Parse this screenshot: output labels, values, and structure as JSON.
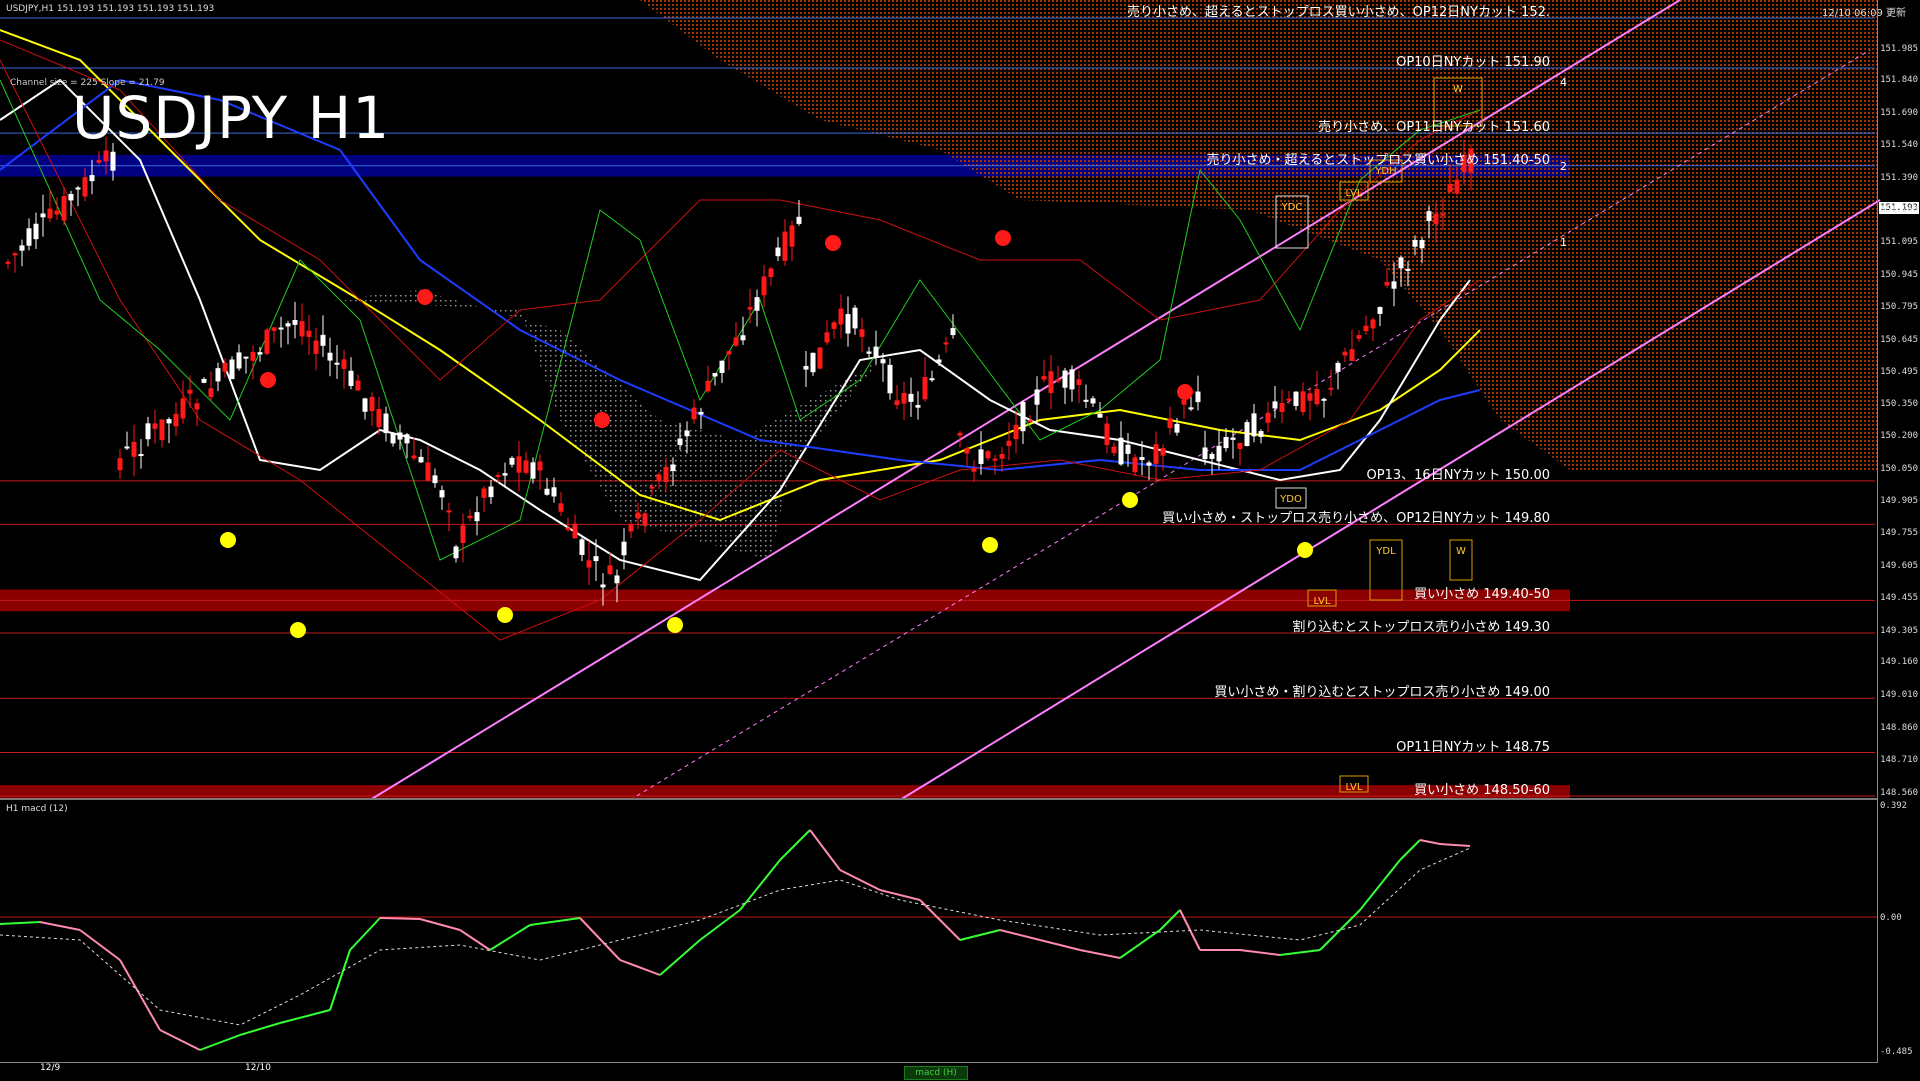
{
  "header": {
    "symbol_info": "USDJPY,H1  151.193 151.193 151.193 151.193",
    "timestamp": "12/10 06:09 更新",
    "title": "USDJPY H1",
    "channel_info": "Channel size = 225 Slope = 21.79"
  },
  "macd_panel": {
    "label": "H1  macd (12)",
    "tab_label": "macd (H)",
    "axis": [
      "0.392",
      "0.00",
      "-0.485"
    ]
  },
  "price_axis": [
    "151.985",
    "151.840",
    "151.690",
    "151.540",
    "151.390",
    "151.240",
    "151.095",
    "150.945",
    "150.795",
    "150.645",
    "150.495",
    "150.350",
    "150.200",
    "150.050",
    "149.905",
    "149.755",
    "149.605",
    "149.455",
    "149.305",
    "149.160",
    "149.010",
    "148.860",
    "148.710",
    "148.560"
  ],
  "current_price": "151.193",
  "annotations": [
    {
      "text": "売り小さめ、超えるとストップロス買い小さめ、OP12日NYカット 152.",
      "price": 152.13
    },
    {
      "text": "OP10日NYカット 151.90",
      "price": 151.9
    },
    {
      "text": "売り小さめ、OP11日NYカット 151.60",
      "price": 151.6
    },
    {
      "text": "売り小さめ・超えるとストップロス買い小さめ 151.40-50",
      "price": 151.45
    },
    {
      "text": "OP13、16日NYカット 150.00",
      "price": 150.0
    },
    {
      "text": "買い小さめ・ストップロス売り小さめ、OP12日NYカット 149.80",
      "price": 149.8
    },
    {
      "text": "買い小さめ 149.40-50",
      "price": 149.45
    },
    {
      "text": "割り込むとストップロス売り小さめ 149.30",
      "price": 149.3
    },
    {
      "text": "買い小さめ・割り込むとストップロス売り小さめ 149.00",
      "price": 149.0
    },
    {
      "text": "OP11日NYカット 148.75",
      "price": 148.75
    },
    {
      "text": "買い小さめ 148.50-60",
      "price": 148.55
    }
  ],
  "markers": {
    "ydh": "YDH",
    "ydc": "YDC",
    "ydo": "YDO",
    "ydl": "YDL",
    "lvl1": "LVL",
    "lvl2": "LVL",
    "lvl3": "LVL",
    "w1": "W",
    "w2": "W",
    "ch1": "1",
    "ch2": "2",
    "ch4": "4"
  },
  "dates": {
    "d1": "12/9",
    "d2": "12/10"
  },
  "colors": {
    "buy_zone": "#8b0000",
    "sell_zone": "#000080",
    "cloud": "#b33a00",
    "ma_short": "#ffffff",
    "ma_mid": "#ffff00",
    "ma_long": "#1e3cff",
    "channel": "#ff7fff",
    "macd_main": "#33ff33",
    "macd_neg": "#ff8ab0"
  }
}
